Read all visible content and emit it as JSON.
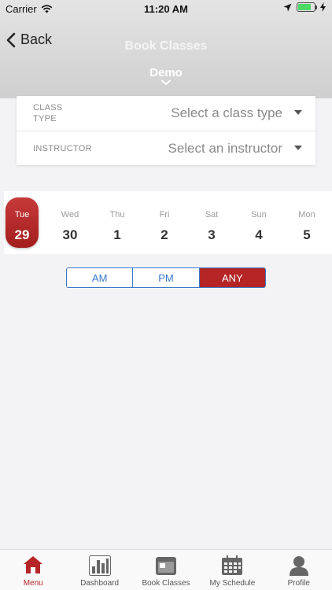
{
  "status_bar": {
    "carrier": "Carrier",
    "time": "11:20 AM"
  },
  "nav": {
    "back_label": "Back",
    "title": "Book Classes",
    "location": "Demo"
  },
  "filters": {
    "class_type": {
      "label_line1": "CLASS",
      "label_line2": "TYPE",
      "placeholder": "Select a class type"
    },
    "instructor": {
      "label": "INSTRUCTOR",
      "placeholder": "Select an instructor"
    }
  },
  "days": [
    {
      "name": "Tue",
      "num": "29",
      "selected": true
    },
    {
      "name": "Wed",
      "num": "30"
    },
    {
      "name": "Thu",
      "num": "1"
    },
    {
      "name": "Fri",
      "num": "2"
    },
    {
      "name": "Sat",
      "num": "3"
    },
    {
      "name": "Sun",
      "num": "4"
    },
    {
      "name": "Mon",
      "num": "5"
    }
  ],
  "time_filter": {
    "options": [
      "AM",
      "PM",
      "ANY"
    ],
    "selected": "ANY"
  },
  "tabs": [
    {
      "label": "Menu",
      "icon": "home-icon"
    },
    {
      "label": "Dashboard",
      "icon": "bar-chart-icon"
    },
    {
      "label": "Book Classes",
      "icon": "calendar-card-icon"
    },
    {
      "label": "My Schedule",
      "icon": "calendar-icon"
    },
    {
      "label": "Profile",
      "icon": "person-icon"
    }
  ],
  "colors": {
    "accent": "#b52525",
    "link": "#3a78c8",
    "header": "#d8d8d8"
  }
}
